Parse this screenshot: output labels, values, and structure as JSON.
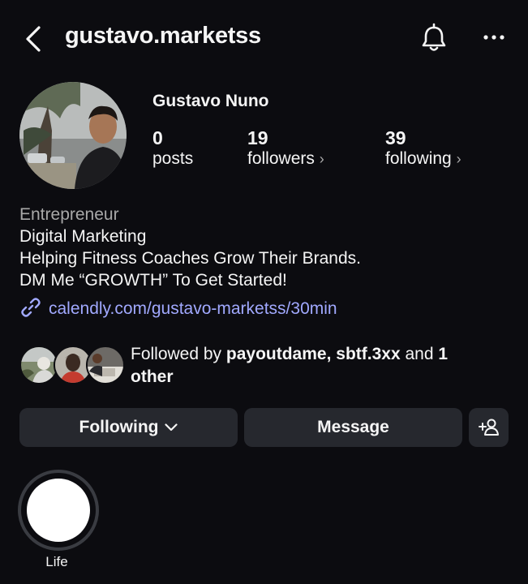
{
  "header": {
    "username": "gustavo.marketss"
  },
  "profile": {
    "full_name": "Gustavo Nuno",
    "stats": {
      "posts": {
        "count": "0",
        "label": "posts"
      },
      "followers": {
        "count": "19",
        "label": "followers"
      },
      "following": {
        "count": "39",
        "label": "following"
      }
    },
    "bio": {
      "category": "Entrepreneur",
      "line1": "Digital Marketing",
      "line2": "Helping Fitness Coaches Grow Their Brands.",
      "line3": "DM Me “GROWTH” To Get Started!",
      "link": "calendly.com/gustavo-marketss/30min"
    },
    "followed_by": {
      "prefix": "Followed by ",
      "user1": "payoutdame",
      "sep": ", ",
      "user2": "sbtf.3xx",
      "and": " and ",
      "others": "1 other"
    }
  },
  "buttons": {
    "following": "Following",
    "message": "Message"
  },
  "highlights": [
    {
      "label": "Life"
    }
  ],
  "colors": {
    "background": "#0c0c10",
    "button": "#26282e",
    "link": "#a1a9ff",
    "muted": "#a8a8a8"
  }
}
